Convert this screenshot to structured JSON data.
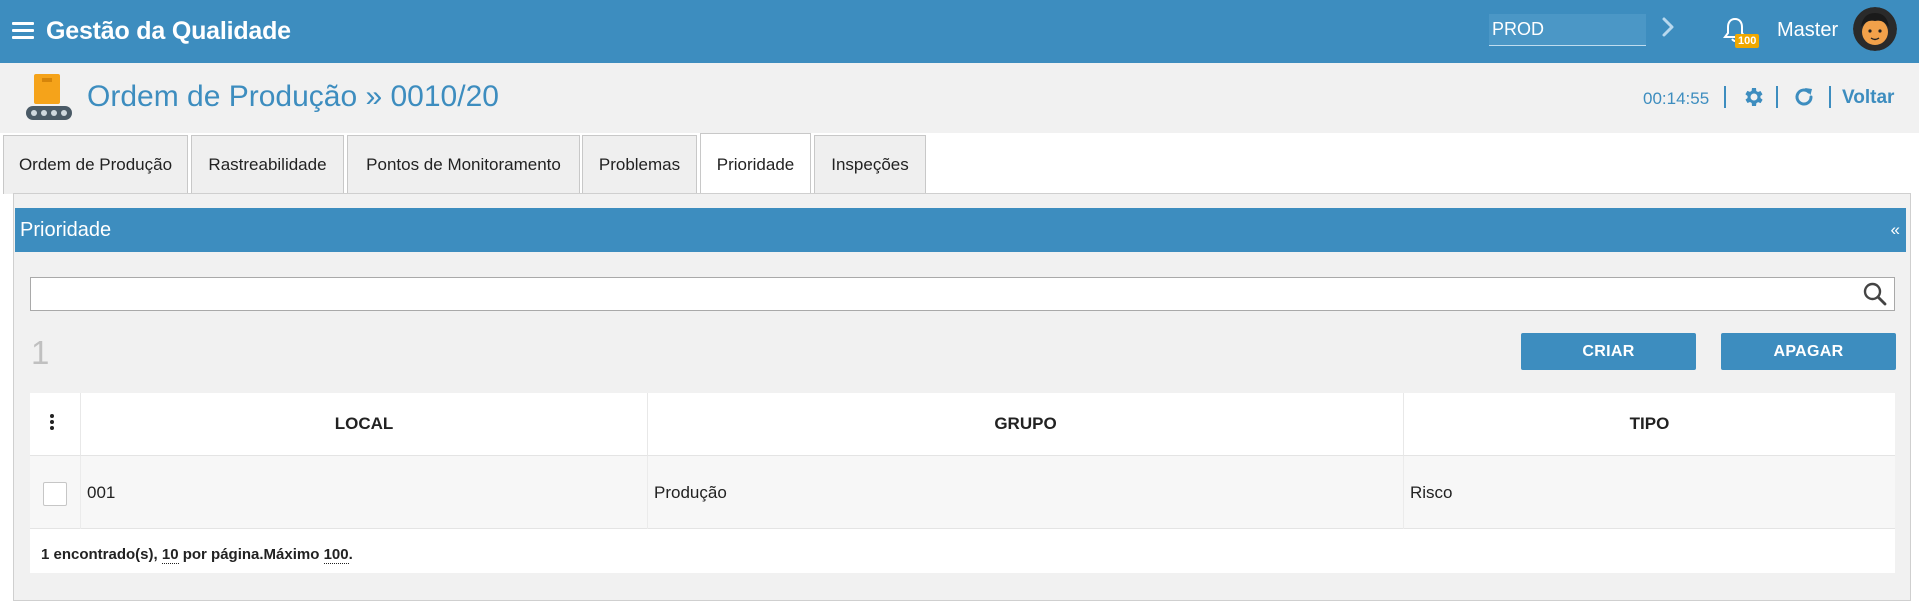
{
  "app": {
    "title": "Gestão da Qualidade"
  },
  "header": {
    "environment_value": "PROD",
    "notifications_count": "100",
    "user_name": "Master"
  },
  "page": {
    "title": "Ordem de Produção » 0010/20",
    "timer": "00:14:55",
    "back_label": "Voltar"
  },
  "tabs": [
    {
      "label": "Ordem de Produção",
      "active": false
    },
    {
      "label": "Rastreabilidade",
      "active": false
    },
    {
      "label": "Pontos de Monitoramento",
      "active": false
    },
    {
      "label": "Problemas",
      "active": false
    },
    {
      "label": "Prioridade",
      "active": true
    },
    {
      "label": "Inspeções",
      "active": false
    }
  ],
  "panel": {
    "title": "Prioridade",
    "collapse_label": "«",
    "search_value": "",
    "record_count": "1",
    "create_label": "CRIAR",
    "delete_label": "APAGAR"
  },
  "table": {
    "columns": [
      "LOCAL",
      "GRUPO",
      "TIPO"
    ],
    "rows": [
      {
        "local": "001",
        "grupo": "Produção",
        "tipo": "Risco"
      }
    ],
    "footer": {
      "found": "1 encontrado(s), ",
      "per_page_value": "10",
      "per_page_text": " por página.Máximo ",
      "max_value": "100",
      "end": "."
    }
  },
  "colors": {
    "primary": "#3d8dbf",
    "badge": "#f0a800",
    "background": "#f1f1f1"
  },
  "icons": [
    "hamburger-icon",
    "chevron-right-icon",
    "bell-icon",
    "avatar",
    "conveyor-box-icon",
    "gear-icon",
    "refresh-icon",
    "search-icon",
    "kebab-menu-icon"
  ]
}
